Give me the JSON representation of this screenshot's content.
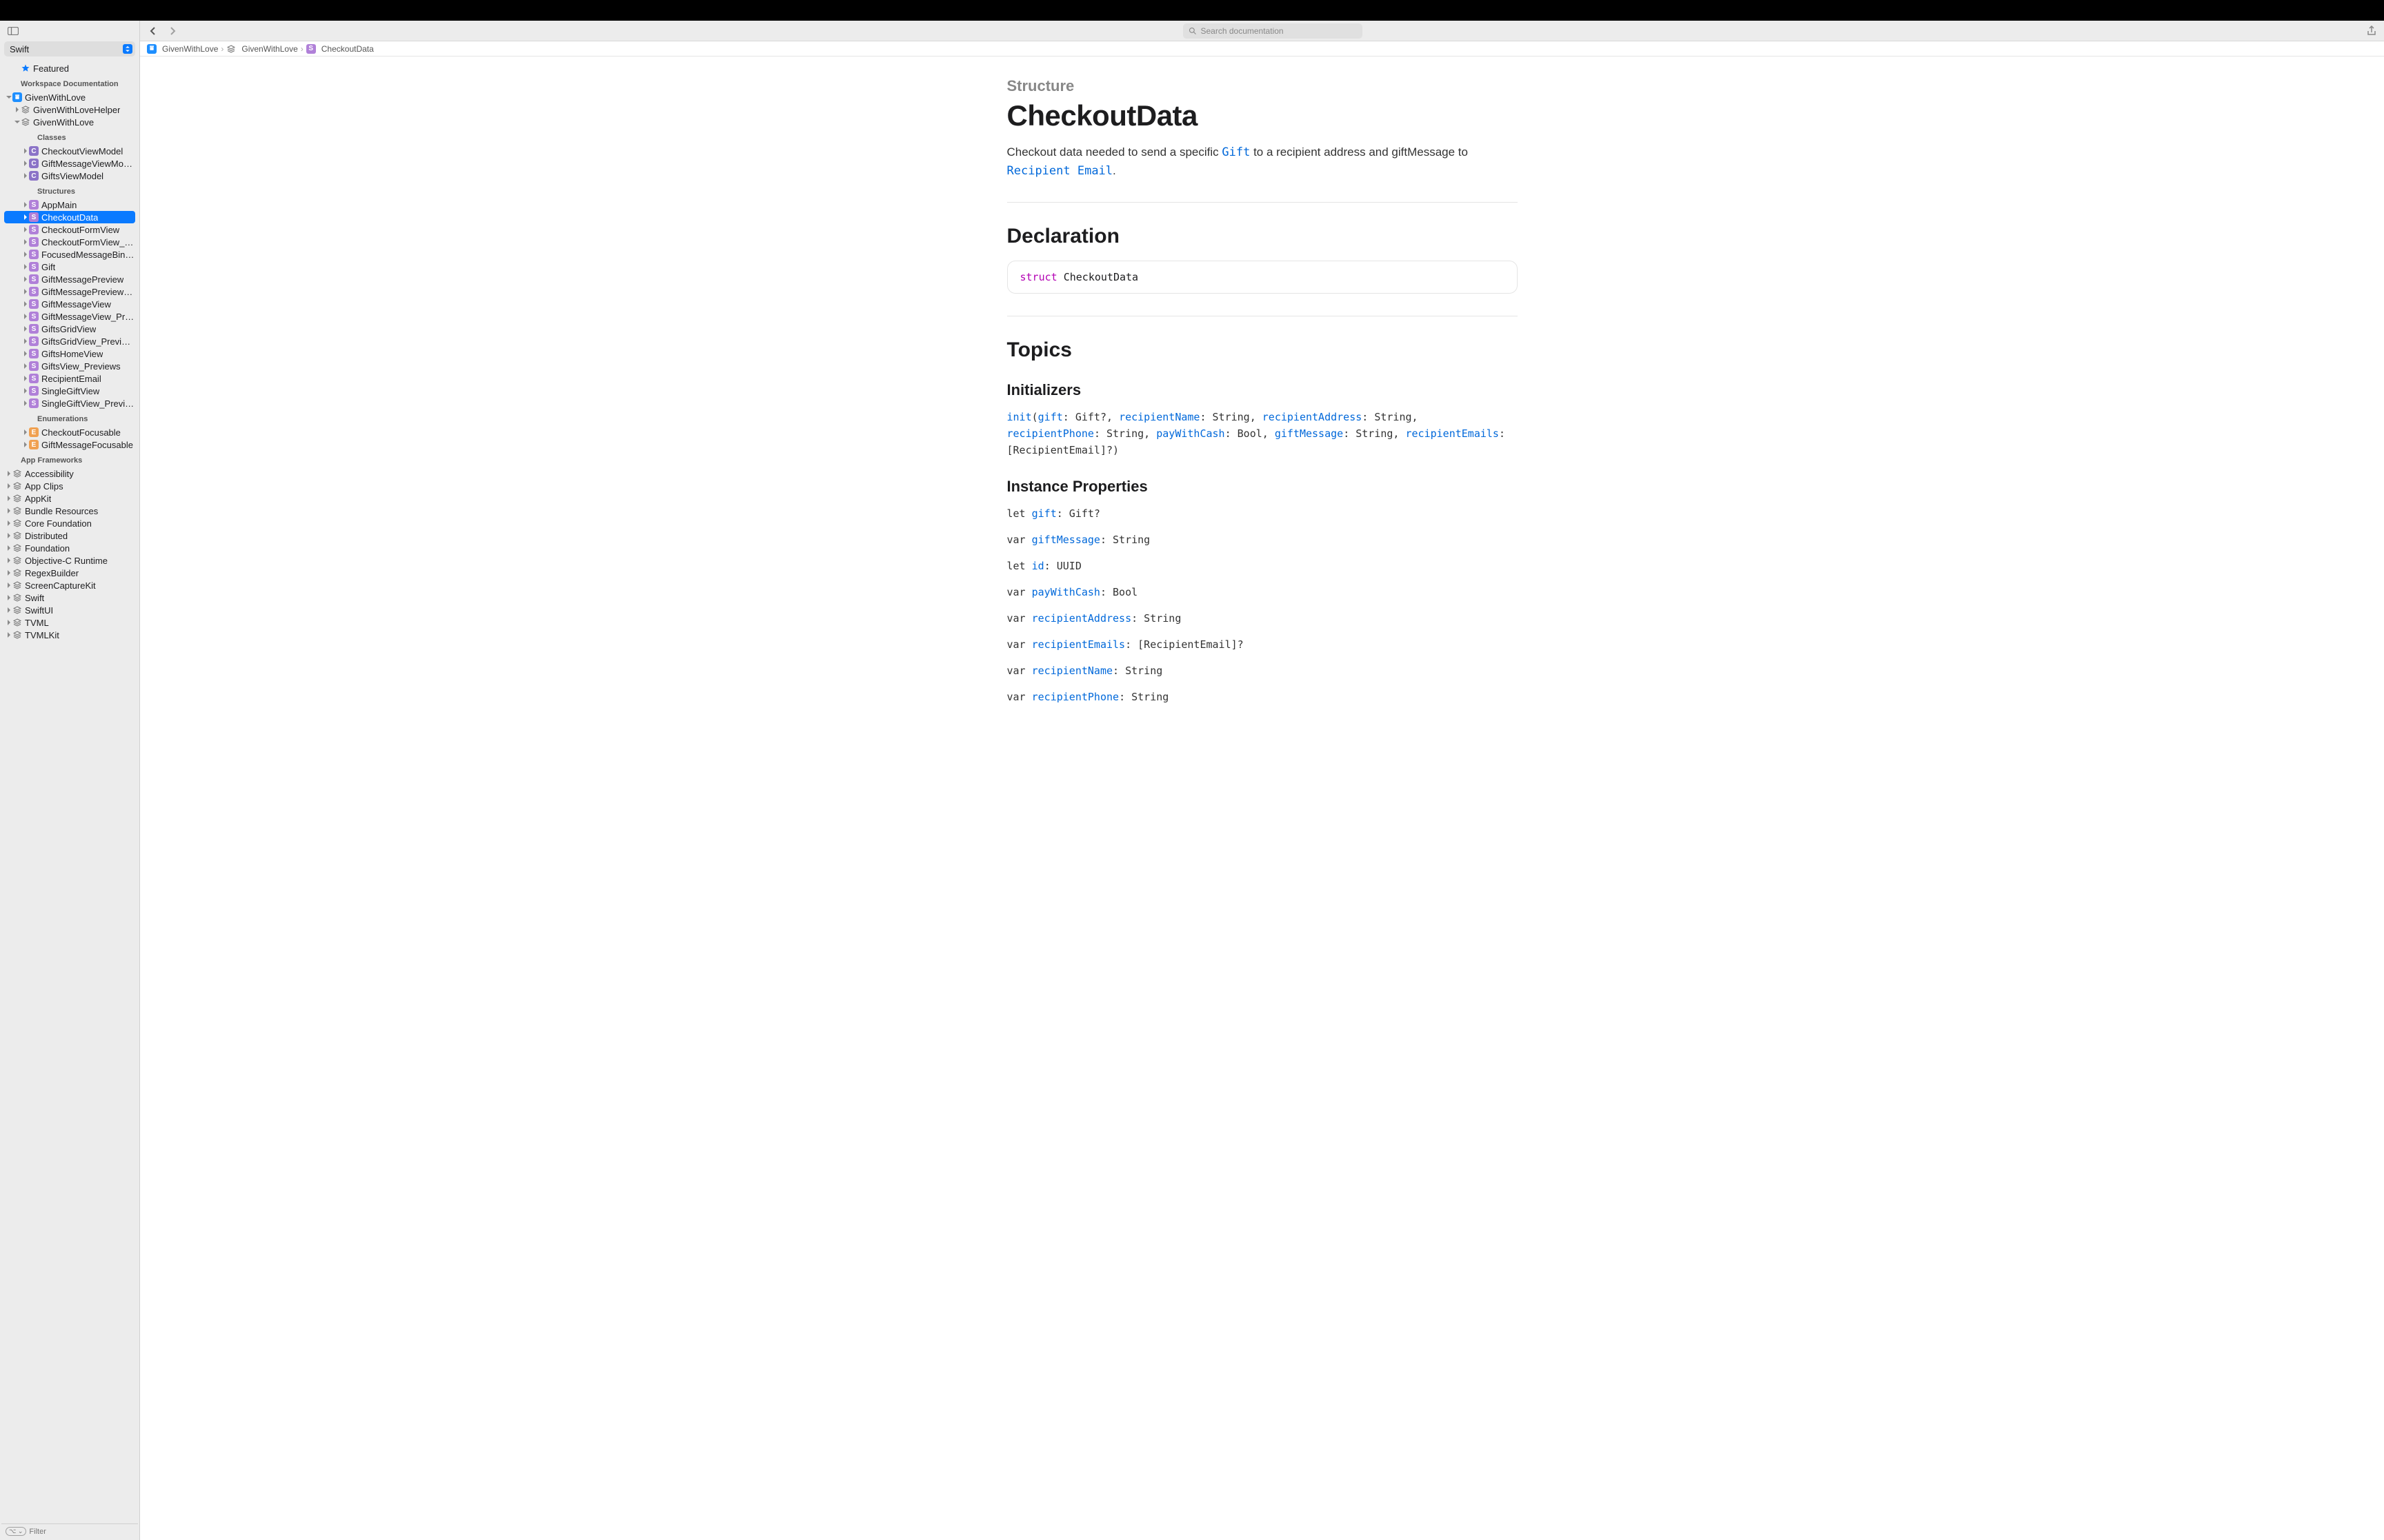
{
  "langPicker": {
    "value": "Swift"
  },
  "search": {
    "placeholder": "Search documentation"
  },
  "filter": {
    "placeholder": "Filter",
    "badge": "⌥ ⌄"
  },
  "breadcrumbs": [
    {
      "icon": "app",
      "label": "GivenWithLove"
    },
    {
      "icon": "stack",
      "label": "GivenWithLove"
    },
    {
      "icon": "S",
      "label": "CheckoutData"
    }
  ],
  "sidebar": {
    "featured": "Featured",
    "workspaceHeader": "Workspace Documentation",
    "appFrameworksHeader": "App Frameworks",
    "project": "GivenWithLove",
    "modules": {
      "helper": "GivenWithLoveHelper",
      "main": "GivenWithLove"
    },
    "groupClasses": "Classes",
    "classes": [
      "CheckoutViewModel",
      "GiftMessageViewModel",
      "GiftsViewModel"
    ],
    "groupStructures": "Structures",
    "structures": [
      "AppMain",
      "CheckoutData",
      "CheckoutFormView",
      "CheckoutFormView_Pre...",
      "FocusedMessageBinding",
      "Gift",
      "GiftMessagePreview",
      "GiftMessagePreview_Pre...",
      "GiftMessageView",
      "GiftMessageView_Previe...",
      "GiftsGridView",
      "GiftsGridView_Previews",
      "GiftsHomeView",
      "GiftsView_Previews",
      "RecipientEmail",
      "SingleGiftView",
      "SingleGiftView_Previews"
    ],
    "groupEnumerations": "Enumerations",
    "enumerations": [
      "CheckoutFocusable",
      "GiftMessageFocusable"
    ],
    "frameworks": [
      "Accessibility",
      "App Clips",
      "AppKit",
      "Bundle Resources",
      "Core Foundation",
      "Distributed",
      "Foundation",
      "Objective-C Runtime",
      "RegexBuilder",
      "ScreenCaptureKit",
      "Swift",
      "SwiftUI",
      "TVML",
      "TVMLKit"
    ]
  },
  "page": {
    "kind": "Structure",
    "title": "CheckoutData",
    "abstract_pre": "Checkout data needed to send a specific ",
    "abstract_link1": "Gift",
    "abstract_mid": " to a recipient address and giftMessage to ",
    "abstract_link2": "Recipient Email",
    "abstract_post": ".",
    "declHeader": "Declaration",
    "decl_kw": "struct",
    "decl_name": " CheckoutData",
    "topicsHeader": "Topics",
    "initializersHeader": "Initializers",
    "init_sig": [
      {
        "t": "link",
        "v": "init"
      },
      {
        "t": "plain",
        "v": "("
      },
      {
        "t": "link",
        "v": "gift"
      },
      {
        "t": "plain",
        "v": ": Gift?, "
      },
      {
        "t": "link",
        "v": "recipientName"
      },
      {
        "t": "plain",
        "v": ": String, "
      },
      {
        "t": "link",
        "v": "recipientAddress"
      },
      {
        "t": "plain",
        "v": ": String, "
      },
      {
        "t": "link",
        "v": "recipientPhone"
      },
      {
        "t": "plain",
        "v": ": String, "
      },
      {
        "t": "link",
        "v": "payWithCash"
      },
      {
        "t": "plain",
        "v": ": Bool, "
      },
      {
        "t": "link",
        "v": "giftMessage"
      },
      {
        "t": "plain",
        "v": ": String, "
      },
      {
        "t": "link",
        "v": "recipientEmails"
      },
      {
        "t": "plain",
        "v": ": [RecipientEmail]?)"
      }
    ],
    "propsHeader": "Instance Properties",
    "props": [
      {
        "pre": "let ",
        "name": "gift",
        "post": ": Gift?"
      },
      {
        "pre": "var ",
        "name": "giftMessage",
        "post": ": String"
      },
      {
        "pre": "let ",
        "name": "id",
        "post": ": UUID"
      },
      {
        "pre": "var ",
        "name": "payWithCash",
        "post": ": Bool"
      },
      {
        "pre": "var ",
        "name": "recipientAddress",
        "post": ": String"
      },
      {
        "pre": "var ",
        "name": "recipientEmails",
        "post": ": [RecipientEmail]?"
      },
      {
        "pre": "var ",
        "name": "recipientName",
        "post": ": String"
      },
      {
        "pre": "var ",
        "name": "recipientPhone",
        "post": ": String"
      }
    ]
  }
}
